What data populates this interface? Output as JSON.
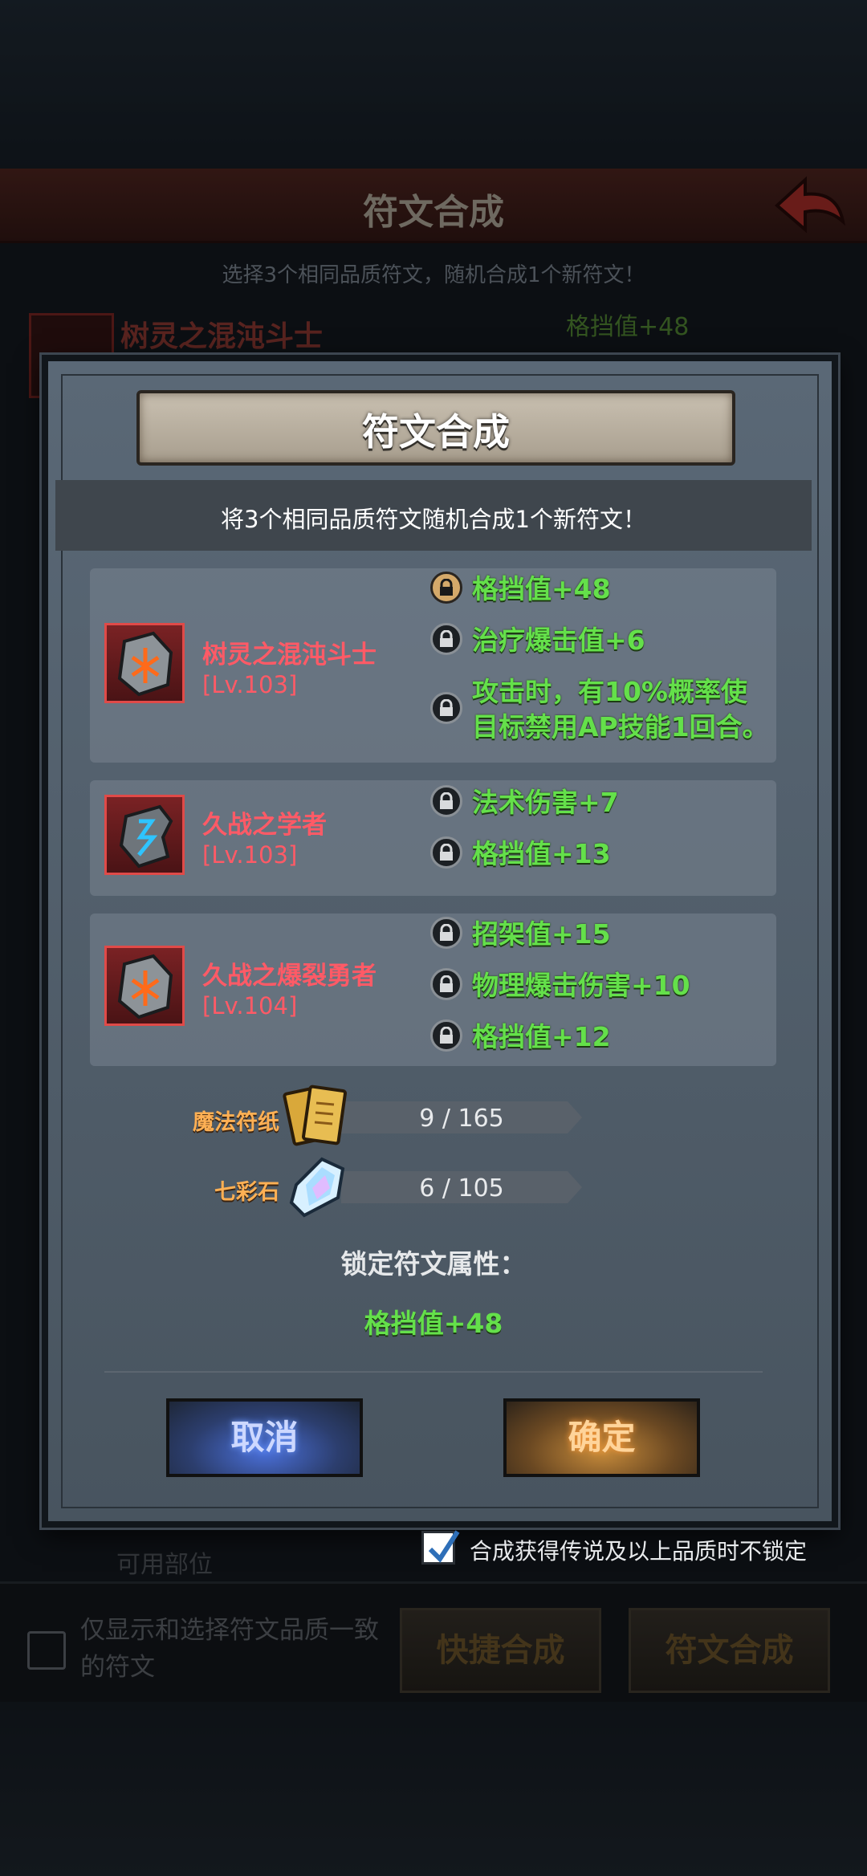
{
  "screen": {
    "title": "符文合成",
    "subtitle": "选择3个相同品质符文，随机合成1个新符文！",
    "bg_card_name": "树灵之混沌斗士",
    "bg_card_stat": "格挡值+48",
    "bg_bottom_row": "可用部位",
    "filter_label": "仅显示和选择符文品质一致的符文",
    "quick_button": "快捷合成",
    "compose_button": "符文合成"
  },
  "dialog": {
    "title": "符文合成",
    "description": "将3个相同品质符文随机合成1个新符文！",
    "runes": [
      {
        "name": "树灵之混沌斗士",
        "level": "[Lv.103]",
        "icon": "orange-rune-stone-icon",
        "stats": [
          {
            "text": "格挡值+48",
            "locked": true
          },
          {
            "text": "治疗爆击值+6",
            "locked": false
          },
          {
            "text": "攻击时，有10%概率使",
            "locked": false,
            "line2": "目标禁用AP技能1回合。"
          }
        ]
      },
      {
        "name": "久战之学者",
        "level": "[Lv.103]",
        "icon": "blue-rune-stone-icon",
        "stats": [
          {
            "text": "法术伤害+7",
            "locked": false
          },
          {
            "text": "格挡值+13",
            "locked": false
          }
        ]
      },
      {
        "name": "久战之爆裂勇者",
        "level": "[Lv.104]",
        "icon": "orange-rune-stone-icon",
        "stats": [
          {
            "text": "招架值+15",
            "locked": false
          },
          {
            "text": "物理爆击伤害+10",
            "locked": false
          },
          {
            "text": "格挡值+12",
            "locked": false
          }
        ]
      }
    ],
    "resources": [
      {
        "label": "魔法符纸",
        "value": "9 / 165",
        "icon": "magic-paper-icon"
      },
      {
        "label": "七彩石",
        "value": "6 / 105",
        "icon": "rainbow-stone-icon"
      }
    ],
    "lock_title": "锁定符文属性：",
    "lock_value": "格挡值+48",
    "cancel_label": "取消",
    "confirm_label": "确定",
    "checkbox_label": "合成获得传说及以上品质时不锁定",
    "checkbox_checked": true
  },
  "colors": {
    "stat_green": "#64e04a",
    "rune_name_red": "#ff5a66",
    "resource_orange": "#ffb054"
  }
}
